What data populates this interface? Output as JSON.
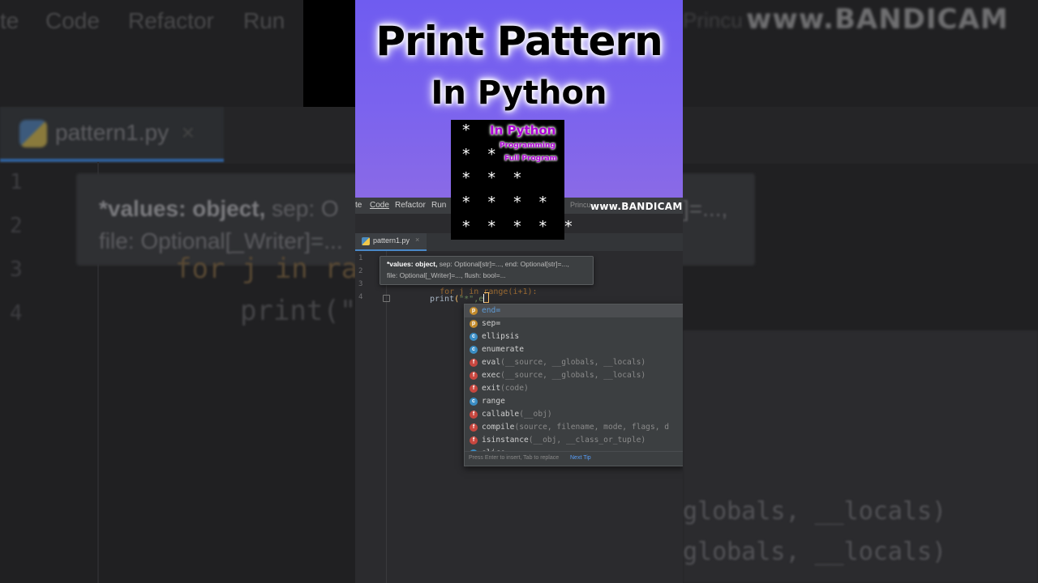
{
  "background": {
    "menu": [
      "te",
      "Code",
      "Refactor",
      "Run"
    ],
    "watermark": "www.BANDICAM",
    "princu": "Princu",
    "tab_label": "pattern1.py",
    "tab_close": "×",
    "line_numbers": [
      "1",
      "2",
      "3",
      "4"
    ],
    "tooltip_bold": "*values: object,",
    "tooltip_rest": " sep: O",
    "tooltip_line2": "file: Optional[_Writer]=...",
    "tooltip_tail": "]=...,",
    "code_line3": "for j in ra",
    "code_line4": "print(\"",
    "popup_sig1": "globals, __locals)",
    "popup_sig2": "globals, __locals)"
  },
  "thumbnail": {
    "title_line1": "Print Pattern",
    "title_line2": "In Python",
    "pattern_rows": [
      "*",
      "* *",
      "* * *",
      "* * * *",
      "* * * * *"
    ],
    "badge_main": "In Python",
    "badge_sub1": "Programming",
    "badge_sub2": "Full Program"
  },
  "ide": {
    "menu": [
      "te",
      "Code",
      "Refactor",
      "Run"
    ],
    "princu": "Princu",
    "watermark": "www.BANDICAM",
    "tab": {
      "label": "pattern1.py",
      "close": "×"
    },
    "line_numbers": [
      "1",
      "2",
      "3",
      "4"
    ],
    "code": {
      "line3": "for j in range(",
      "line3_tail": "i+1):",
      "line4_fn": "print",
      "line4_args": "\"*\",e"
    },
    "tooltip": {
      "bold": "*values: object,",
      "rest": " sep: Optional[str]=..., end: Optional[str]=...,",
      "line2": "file: Optional[_Writer]=..., flush: bool=..."
    },
    "completion": {
      "items": [
        {
          "kind": "p",
          "name": "end=",
          "sig": ""
        },
        {
          "kind": "p",
          "name": "sep=",
          "sig": ""
        },
        {
          "kind": "c",
          "name": "ellipsis",
          "sig": ""
        },
        {
          "kind": "c",
          "name": "enumerate",
          "sig": ""
        },
        {
          "kind": "f",
          "name": "eval",
          "sig": "(__source, __globals, __locals)"
        },
        {
          "kind": "f",
          "name": "exec",
          "sig": "(__source, __globals, __locals)"
        },
        {
          "kind": "f",
          "name": "exit",
          "sig": "(code)"
        },
        {
          "kind": "c",
          "name": "range",
          "sig": ""
        },
        {
          "kind": "f",
          "name": "callable",
          "sig": "(__obj)"
        },
        {
          "kind": "f",
          "name": "compile",
          "sig": "(source, filename, mode, flags, d"
        },
        {
          "kind": "f",
          "name": "isinstance",
          "sig": "(__obj, __class_or_tuple)"
        },
        {
          "kind": "f",
          "name": "slice",
          "sig": ""
        }
      ],
      "footer_hint": "Press Enter to insert, Tab to replace",
      "footer_tip": "Next Tip"
    }
  }
}
